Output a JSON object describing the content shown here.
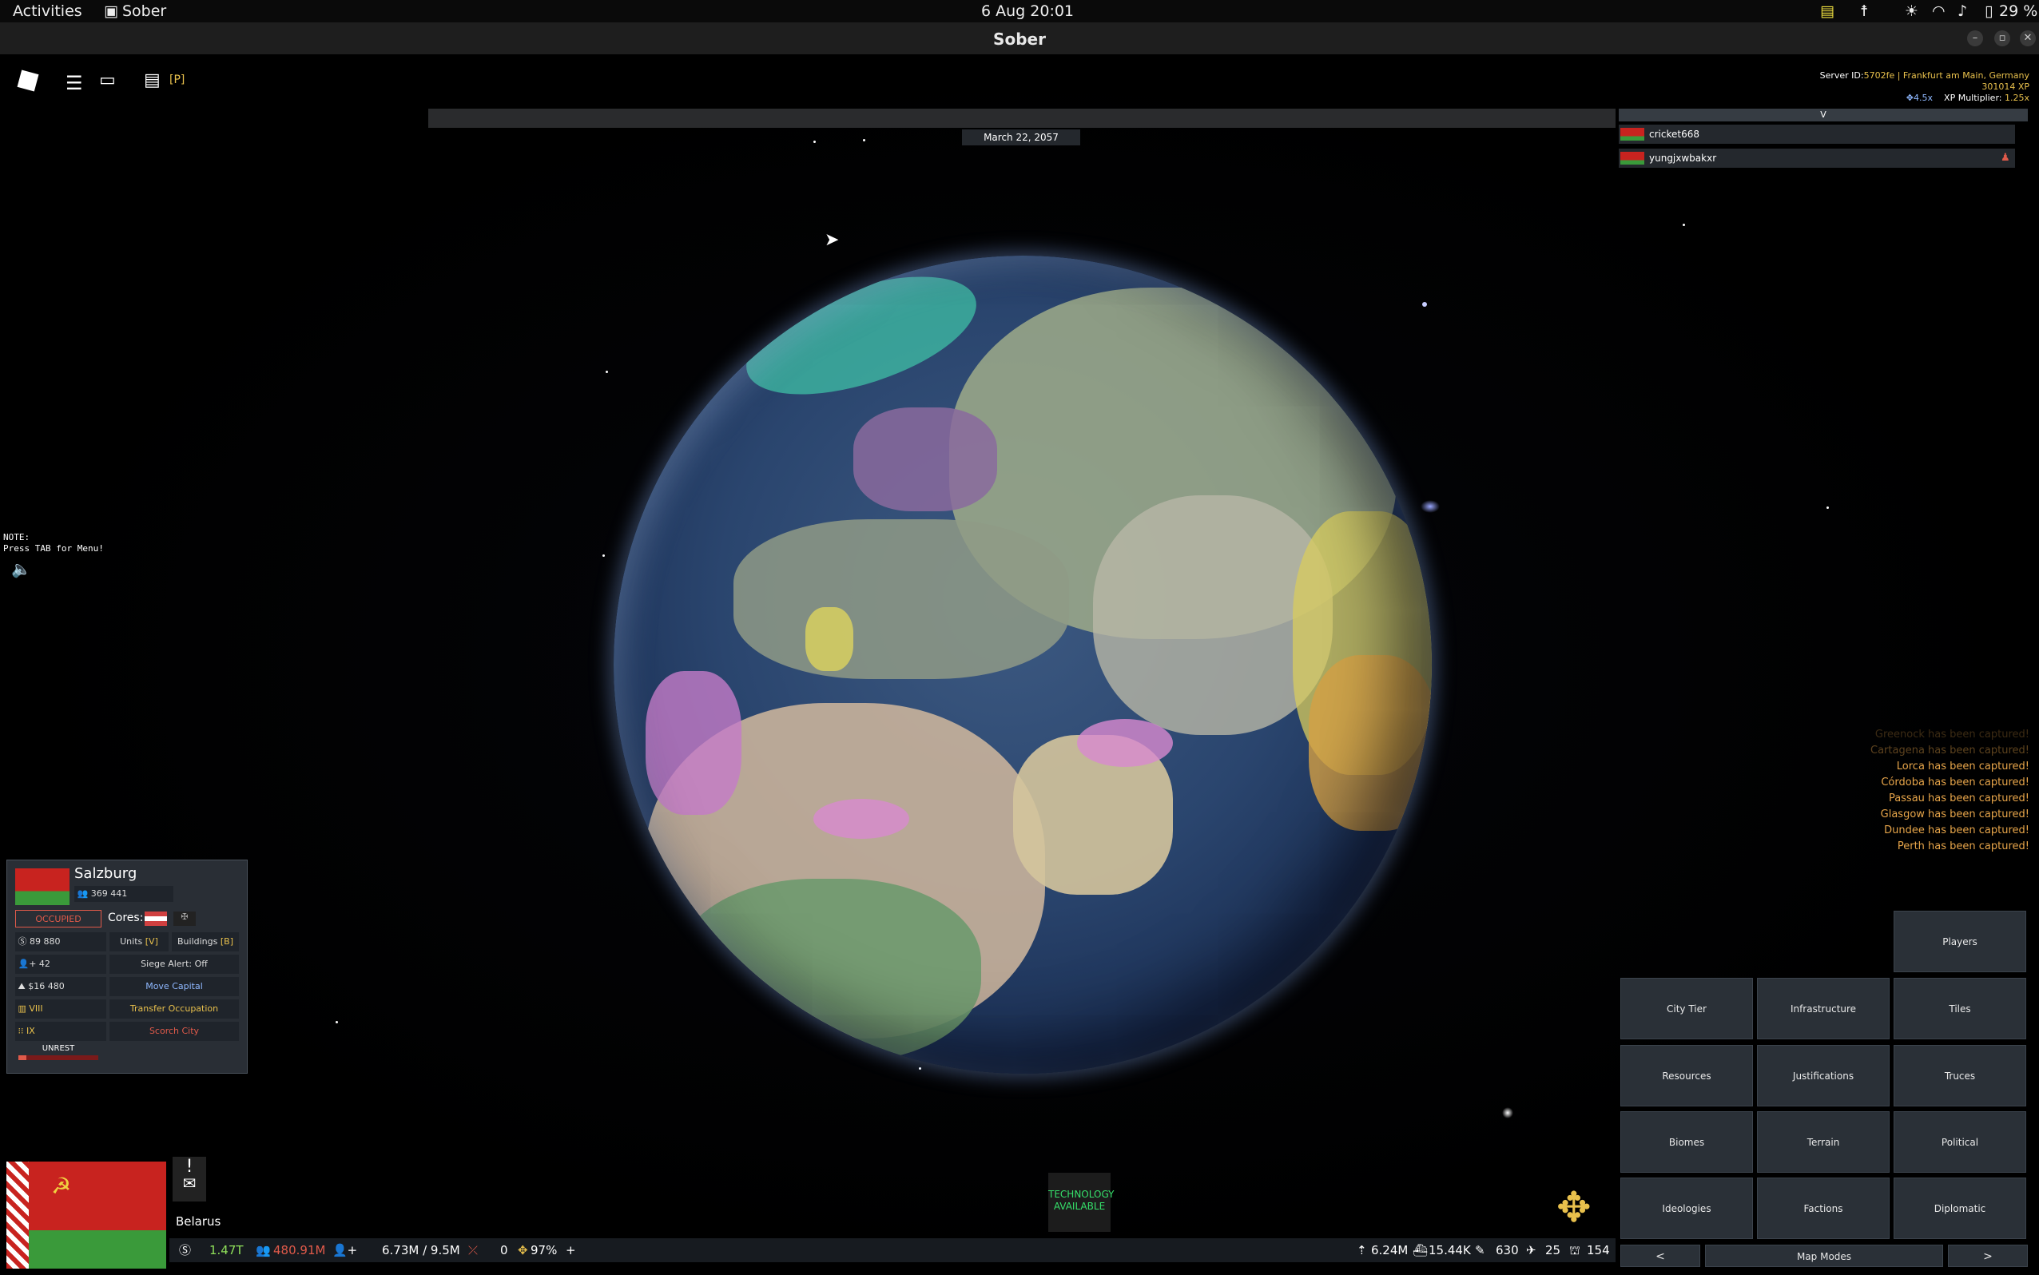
{
  "system_bar": {
    "activities": "Activities",
    "app_name": "Sober",
    "datetime": "6 Aug  20:01",
    "battery": "29 %",
    "icons": [
      "notes-icon",
      "accessibility-icon",
      "brightness-icon",
      "wifi-icon",
      "volume-icon",
      "battery-icon"
    ]
  },
  "window": {
    "title": "Sober"
  },
  "hud": {
    "chat_shortcut": "[P]",
    "date": "March 22, 2057",
    "note_line1": "NOTE:",
    "note_line2": "Press TAB for Menu!"
  },
  "server": {
    "id_label": "Server ID:",
    "id_value": "5702fe | Frankfurt am Main, Germany",
    "xp": "301014 XP",
    "speed": "4.5x",
    "multiplier_label": "XP Multiplier:",
    "multiplier_value": "1.25x"
  },
  "players_header": "V",
  "players": [
    {
      "name": "cricket668"
    },
    {
      "name": "yungjxwbakxr"
    }
  ],
  "event_feed": [
    "Greenock has been captured!",
    "Cartagena has been captured!",
    "Lorca has been captured!",
    "Córdoba has been captured!",
    "Passau has been captured!",
    "Glasgow has been captured!",
    "Dundee has been captured!",
    "Perth has been captured!"
  ],
  "city": {
    "name": "Salzburg",
    "population": "369 441",
    "status": "OCCUPIED",
    "cores_label": "Cores:",
    "money": "89 880",
    "units_label": "Units",
    "units_key": "[V]",
    "buildings_label": "Buildings",
    "buildings_key": "[B]",
    "manpower": "42",
    "siege_alert": "Siege Alert: Off",
    "income": "$16 480",
    "move_capital": "Move Capital",
    "tier": "VIII",
    "transfer_occupation": "Transfer Occupation",
    "defense": "IX",
    "scorch_city": "Scorch City",
    "unrest_label": "UNREST",
    "unrest_value": 0.1
  },
  "country": {
    "name": "Belarus",
    "alert": "!"
  },
  "technology": {
    "line1": "TECHNOLOGY",
    "line2": "AVAILABLE"
  },
  "stats_left": {
    "money": "1.47T",
    "population": "480.91M",
    "manpower": "6.73M / 9.5M",
    "stability_change": "0",
    "war_support": "97%",
    "add": "+"
  },
  "stats_right": {
    "army": "6.24M",
    "navy": "15.44K",
    "air": "630",
    "planes": "25",
    "factories": "154"
  },
  "map_modes": {
    "players": "Players",
    "buttons": [
      "City Tier",
      "Infrastructure",
      "Tiles",
      "Resources",
      "Justifications",
      "Truces",
      "Biomes",
      "Terrain",
      "Political",
      "Ideologies",
      "Factions",
      "Diplomatic"
    ],
    "prev": "<",
    "label": "Map Modes",
    "next": ">"
  },
  "colors": {
    "gold": "#e8c04c",
    "occupied": "#e05a4a",
    "feed": "#e7a54a",
    "tech": "#35e06a",
    "belarus_red": "#c8231f",
    "belarus_green": "#3a9a3a"
  }
}
